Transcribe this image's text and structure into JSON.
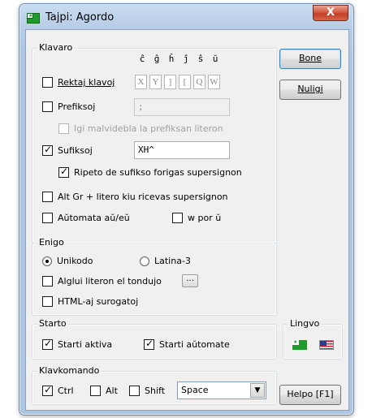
{
  "window": {
    "title": "Tajpi: Agordo",
    "close_label": "X"
  },
  "klavaro": {
    "title": "Klavaro",
    "chars": [
      "ĉ",
      "ĝ",
      "ĥ",
      "ĵ",
      "ŝ",
      "ŭ"
    ],
    "rektaj": {
      "label": "Rektaj klavoj",
      "checked": false,
      "keys": [
        "X",
        "Y",
        "]",
        "[",
        "Q",
        "W"
      ]
    },
    "prefiksoj": {
      "label": "Prefiksoj",
      "checked": false,
      "value": ";"
    },
    "igi": {
      "label": "Igi malvidebla la prefiksan literon",
      "checked": false,
      "disabled": true
    },
    "sufiksoj": {
      "label": "Sufiksoj",
      "checked": true,
      "value": "XH^"
    },
    "ripeto": {
      "label": "Ripeto de sufikso forigas supersignon",
      "checked": true
    },
    "altgr": {
      "label": "Alt Gr + litero kiu ricevas supersignon",
      "checked": false
    },
    "automata": {
      "label": "Aŭtomata aŭ/eŭ",
      "checked": false
    },
    "wpor": {
      "label": "w por ŭ",
      "checked": false
    }
  },
  "enigo": {
    "title": "Enigo",
    "unikodo": {
      "label": "Unikodo",
      "selected": true
    },
    "latina": {
      "label": "Latina-3",
      "selected": false
    },
    "alglui": {
      "label": "Alglui literon el tondujo",
      "checked": false,
      "button": "..."
    },
    "html": {
      "label": "HTML-aj surogatoj",
      "checked": false
    }
  },
  "starto": {
    "title": "Starto",
    "aktiva": {
      "label": "Starti aktiva",
      "checked": true
    },
    "automate": {
      "label": "Starti aŭtomate",
      "checked": true
    }
  },
  "lingvo": {
    "title": "Lingvo",
    "flags": [
      "esperanto-flag",
      "usa-flag"
    ]
  },
  "klavkomando": {
    "title": "Klavkomando",
    "ctrl": {
      "label": "Ctrl",
      "checked": true
    },
    "alt": {
      "label": "Alt",
      "checked": false
    },
    "shift": {
      "label": "Shift",
      "checked": false
    },
    "key": "Space"
  },
  "buttons": {
    "bone": "Bone",
    "nuligi": "Nuligi",
    "helpo": "Helpo [F1]"
  },
  "colors": {
    "title_gradient_top": "#c9dcf0",
    "close_red": "#c23e25",
    "dialog_bg": "#f0f0f0"
  }
}
